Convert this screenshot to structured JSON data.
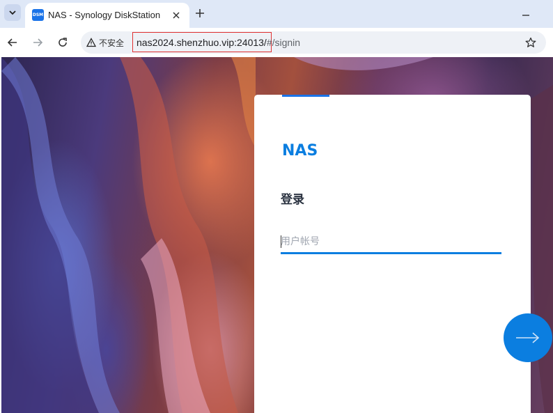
{
  "browser": {
    "tab": {
      "favicon_text": "DSM",
      "title": "NAS - Synology DiskStation"
    },
    "icons": {
      "tab_menu": "chevron-down-icon",
      "close": "close-icon",
      "new_tab": "plus-icon",
      "minimize": "minimize-icon",
      "back": "back-arrow-icon",
      "forward": "forward-arrow-icon",
      "reload": "reload-icon",
      "warning": "warning-icon",
      "bookmark": "star-icon"
    },
    "address_bar": {
      "security_label": "不安全",
      "url_host": "nas2024.shenzhuo.vip:24013/",
      "url_path": "#/signin"
    }
  },
  "login": {
    "brand": "NAS",
    "heading": "登录",
    "username_placeholder": "用户帐号",
    "next_icon": "arrow-right-icon"
  },
  "colors": {
    "accent": "#0b7ee0",
    "highlight_border": "#e03030"
  }
}
